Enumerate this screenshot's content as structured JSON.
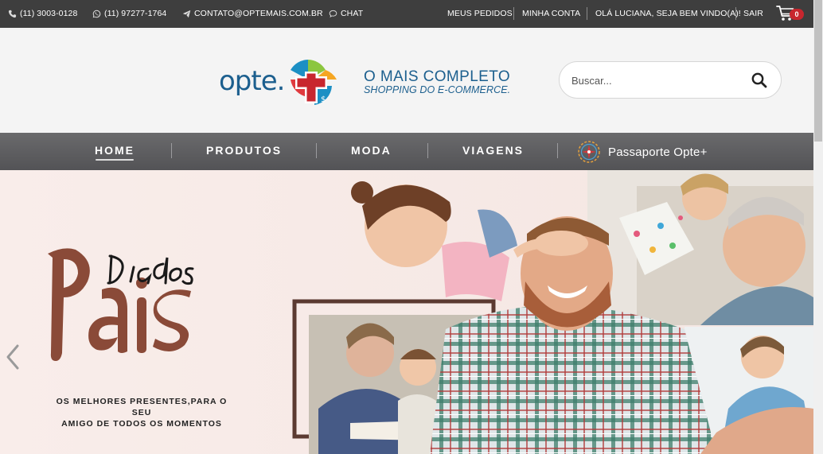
{
  "topbar": {
    "phone": "(11) 3003-0128",
    "whatsapp": "(11) 97277-1764",
    "email": "CONTATO@OPTEMAIS.COM.BR",
    "chat": "CHAT",
    "my_orders": "MEUS PEDIDOS",
    "my_account": "MINHA CONTA",
    "greeting": "OLÁ LUCIANA, SEJA BEM VINDO(A)!",
    "logout": "SAIR",
    "cart_count": "0"
  },
  "header": {
    "logo_text": "opte.",
    "tagline_line1": "O MAIS COMPLETO",
    "tagline_line2": "SHOPPING DO E-COMMERCE.",
    "search_placeholder": "Buscar..."
  },
  "nav": {
    "items": [
      {
        "label": "HOME",
        "active": true
      },
      {
        "label": "PRODUTOS"
      },
      {
        "label": "MODA"
      },
      {
        "label": "VIAGENS"
      }
    ],
    "passport_label": "Passaporte Opte+"
  },
  "hero": {
    "title_line1": "Dia dos",
    "title_line2": "Pais",
    "subtitle_line1": "OS MELHORES PRESENTES,PARA O SEU",
    "subtitle_line2": "AMIGO DE TODOS OS MOMENTOS"
  },
  "colors": {
    "topbar_bg": "#3e3e3e",
    "brand_blue": "#1c5f8e",
    "cart_badge": "#c8262e",
    "hero_title": "#8a4a38"
  }
}
